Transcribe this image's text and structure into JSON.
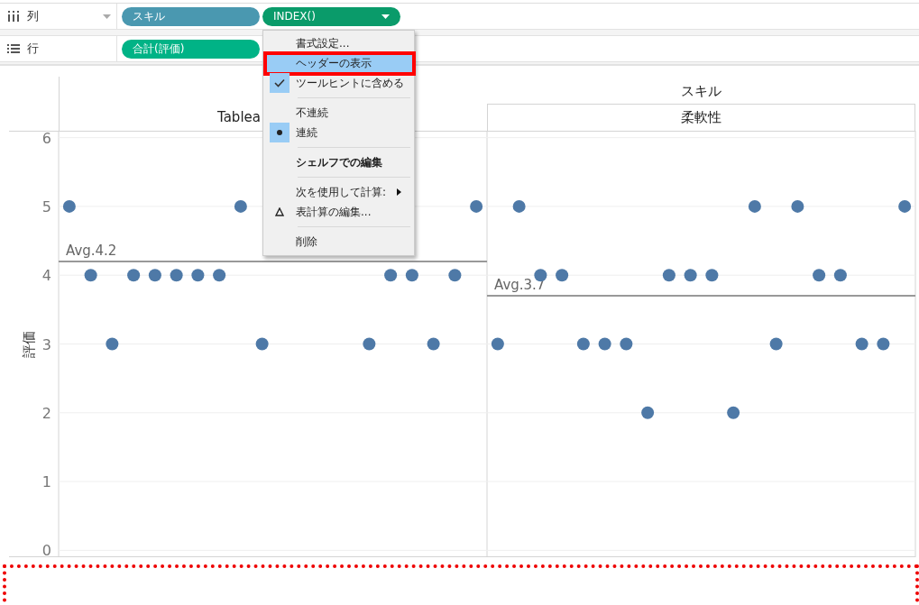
{
  "shelves": [
    {
      "kind": "columns",
      "label": "列",
      "dropdown": true,
      "pills": [
        {
          "label": "スキル",
          "color": "#4a98b0",
          "menu_caret": false
        },
        {
          "label": "INDEX()",
          "color": "#0a9b6a",
          "menu_caret": true
        }
      ]
    },
    {
      "kind": "rows",
      "label": "行",
      "dropdown": false,
      "pills": [
        {
          "label": "合計(評価)",
          "color": "#00b386",
          "menu_caret": false
        }
      ]
    }
  ],
  "context_menu": {
    "items": [
      {
        "kind": "command",
        "label": "書式設定...",
        "selected": false,
        "outlined": false
      },
      {
        "kind": "command",
        "label": "ヘッダーの表示",
        "selected": true,
        "outlined": true
      },
      {
        "kind": "toggle",
        "label": "ツールヒントに含める",
        "checked": true,
        "selected": false,
        "outlined": false
      },
      {
        "kind": "separator"
      },
      {
        "kind": "radio",
        "label": "不連続",
        "checked": false,
        "selected": false,
        "outlined": false
      },
      {
        "kind": "radio",
        "label": "連続",
        "checked": true,
        "selected": false,
        "outlined": false
      },
      {
        "kind": "separator"
      },
      {
        "kind": "default",
        "label": "シェルフでの編集",
        "selected": false,
        "outlined": false
      },
      {
        "kind": "separator"
      },
      {
        "kind": "submenu",
        "label": "次を使用して計算:",
        "selected": false,
        "outlined": false
      },
      {
        "kind": "calc",
        "label": "表計算の編集...",
        "selected": false,
        "outlined": false
      },
      {
        "kind": "separator"
      },
      {
        "kind": "command",
        "label": "削除",
        "selected": false,
        "outlined": false
      }
    ]
  },
  "view": {
    "column_field_title": "スキル",
    "pane_headers": [
      "Tablea",
      "柔軟性"
    ],
    "chart_data": {
      "type": "scatter",
      "ylabel": "評価",
      "ylim": [
        -0.1,
        6.1
      ],
      "yticks": [
        0,
        1,
        2,
        3,
        4,
        5,
        6
      ],
      "grid": true,
      "categories": [
        null,
        null,
        null,
        null,
        null,
        null,
        null,
        null,
        null,
        null,
        null,
        null,
        null,
        null,
        null,
        null,
        null,
        null,
        null,
        null,
        null,
        null,
        null,
        null,
        null,
        null,
        null,
        null,
        null,
        null,
        null,
        null,
        null,
        null,
        null,
        null,
        null,
        null,
        null,
        null
      ],
      "series": [
        {
          "color": "#4e79a7",
          "values": [
            5,
            4,
            3,
            4,
            4,
            4,
            4,
            4,
            5,
            3,
            null,
            null,
            null,
            null,
            3,
            4,
            4,
            3,
            4,
            5,
            3,
            5,
            4,
            4,
            3,
            3,
            3,
            2,
            4,
            4,
            4,
            2,
            5,
            3,
            5,
            4,
            4,
            3,
            3,
            5
          ]
        }
      ],
      "ref_lines": [
        {
          "axis": "y",
          "value": 4.2,
          "label": "Avg.4.2"
        },
        {
          "axis": "y",
          "value": 3.7,
          "label": "Avg.3.7"
        }
      ]
    }
  },
  "overlays": [
    {
      "kind": "dotted-frame"
    }
  ]
}
